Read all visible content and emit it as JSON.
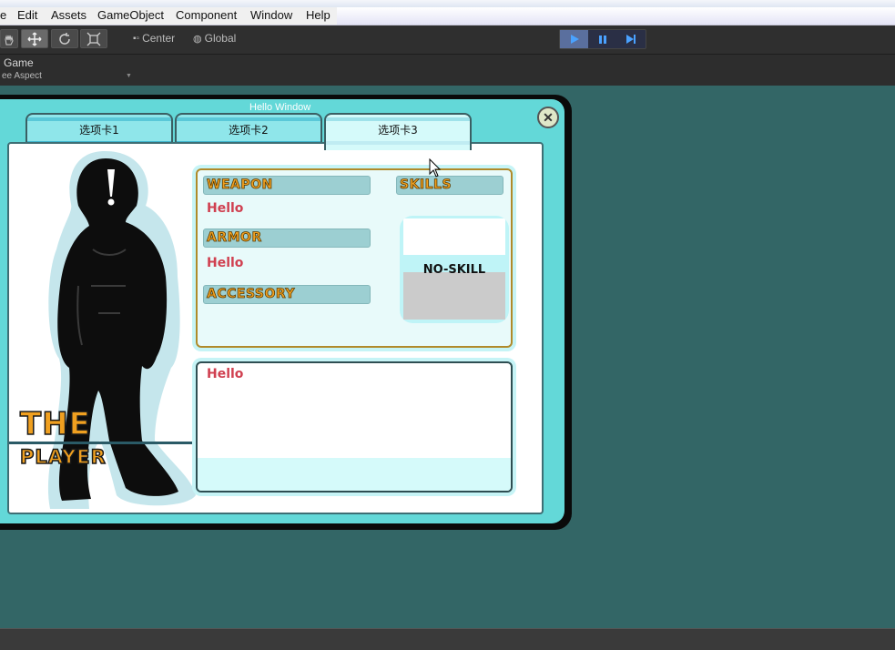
{
  "menubar": {
    "items": [
      "e",
      "Edit",
      "Assets",
      "GameObject",
      "Component",
      "Window",
      "Help"
    ]
  },
  "toolbar": {
    "pivot_label": "Center",
    "rotation_label": "Global"
  },
  "game_view": {
    "tab_label": "Game",
    "aspect_label": "ee Aspect"
  },
  "window": {
    "title": "Hello Window",
    "close_symbol": "✕",
    "tabs": [
      "选项卡1",
      "选项卡2",
      "选项卡3"
    ],
    "active_tab_index": 2,
    "brand_line1": "THE",
    "brand_line2": "PLAYER",
    "weapon_label": "WEAPON",
    "weapon_value": "Hello",
    "armor_label": "ARMOR",
    "armor_value": "Hello",
    "accessory_label": "ACCESSORY",
    "skills_label": "SKILLS",
    "skill_value": "NO-SKILL",
    "description": "Hello"
  },
  "colors": {
    "background": "#336666",
    "accent_orange": "#f0a020",
    "hello_red": "#d04050",
    "window_cyan": "#63d8d8"
  }
}
